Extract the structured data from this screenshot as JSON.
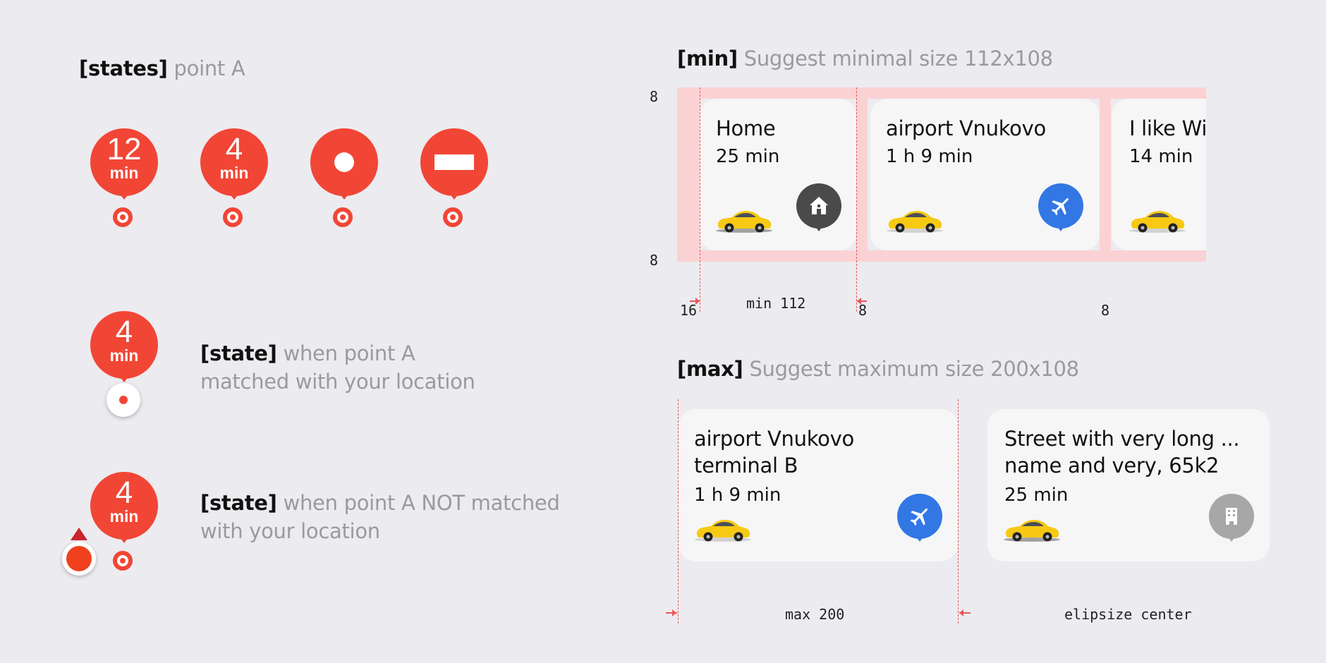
{
  "states_section": {
    "heading_tag": "[states]",
    "heading_rest": "point A",
    "pins": [
      {
        "num": "12",
        "unit": "min"
      },
      {
        "num": "4",
        "unit": "min"
      }
    ]
  },
  "matched_state": {
    "pin_num": "4",
    "pin_unit": "min",
    "tag": "[state]",
    "line1": "when point A",
    "line2": "matched with your location"
  },
  "not_matched_state": {
    "pin_num": "4",
    "pin_unit": "min",
    "tag": "[state]",
    "line1": "when point A NOT matched",
    "line2": "with your location"
  },
  "min_section": {
    "heading_tag": "[min]",
    "heading_rest": "Suggest minimal size 112x108",
    "cards": [
      {
        "title": "Home",
        "time": "25 min",
        "icon": "home-icon",
        "color": "#4a4a4a"
      },
      {
        "title": "airport Vnukovo",
        "time": "1 h 9 min",
        "icon": "airplane-icon",
        "color": "#3277e4"
      },
      {
        "title": "I like Wi",
        "time": "14 min"
      }
    ],
    "dims": {
      "top": "8",
      "bottom": "8",
      "left": "16",
      "min_label": "min 112",
      "gap1": "8",
      "gap2": "8"
    }
  },
  "max_section": {
    "heading_tag": "[max]",
    "heading_rest": "Suggest maximum size 200x108",
    "cards": [
      {
        "title1": "airport Vnukovo",
        "title2": "terminal B",
        "time": "1 h 9 min",
        "icon": "airplane-icon",
        "color": "#3277e4"
      },
      {
        "title1": "Street with very long ...",
        "title2": "name and very, 65k2",
        "time": "25 min",
        "icon": "building-icon",
        "color": "#a7a7a7"
      }
    ],
    "dims": {
      "max_label": "max 200",
      "ellipsize_label": "elipsize center"
    }
  },
  "colors": {
    "pin": "#f14636",
    "guide": "#e8585a",
    "card": "#f6f6f6",
    "taxi": "#f7c913"
  }
}
